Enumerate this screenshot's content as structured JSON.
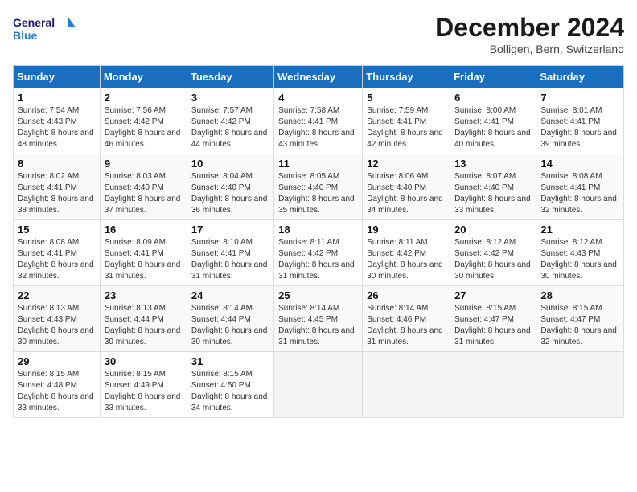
{
  "header": {
    "logo_line1": "General",
    "logo_line2": "Blue",
    "month": "December 2024",
    "location": "Bolligen, Bern, Switzerland"
  },
  "weekdays": [
    "Sunday",
    "Monday",
    "Tuesday",
    "Wednesday",
    "Thursday",
    "Friday",
    "Saturday"
  ],
  "weeks": [
    [
      {
        "day": "1",
        "sunrise": "7:54 AM",
        "sunset": "4:43 PM",
        "daylight": "8 hours and 48 minutes."
      },
      {
        "day": "2",
        "sunrise": "7:56 AM",
        "sunset": "4:42 PM",
        "daylight": "8 hours and 46 minutes."
      },
      {
        "day": "3",
        "sunrise": "7:57 AM",
        "sunset": "4:42 PM",
        "daylight": "8 hours and 44 minutes."
      },
      {
        "day": "4",
        "sunrise": "7:58 AM",
        "sunset": "4:41 PM",
        "daylight": "8 hours and 43 minutes."
      },
      {
        "day": "5",
        "sunrise": "7:59 AM",
        "sunset": "4:41 PM",
        "daylight": "8 hours and 42 minutes."
      },
      {
        "day": "6",
        "sunrise": "8:00 AM",
        "sunset": "4:41 PM",
        "daylight": "8 hours and 40 minutes."
      },
      {
        "day": "7",
        "sunrise": "8:01 AM",
        "sunset": "4:41 PM",
        "daylight": "8 hours and 39 minutes."
      }
    ],
    [
      {
        "day": "8",
        "sunrise": "8:02 AM",
        "sunset": "4:41 PM",
        "daylight": "8 hours and 38 minutes."
      },
      {
        "day": "9",
        "sunrise": "8:03 AM",
        "sunset": "4:40 PM",
        "daylight": "8 hours and 37 minutes."
      },
      {
        "day": "10",
        "sunrise": "8:04 AM",
        "sunset": "4:40 PM",
        "daylight": "8 hours and 36 minutes."
      },
      {
        "day": "11",
        "sunrise": "8:05 AM",
        "sunset": "4:40 PM",
        "daylight": "8 hours and 35 minutes."
      },
      {
        "day": "12",
        "sunrise": "8:06 AM",
        "sunset": "4:40 PM",
        "daylight": "8 hours and 34 minutes."
      },
      {
        "day": "13",
        "sunrise": "8:07 AM",
        "sunset": "4:40 PM",
        "daylight": "8 hours and 33 minutes."
      },
      {
        "day": "14",
        "sunrise": "8:08 AM",
        "sunset": "4:41 PM",
        "daylight": "8 hours and 32 minutes."
      }
    ],
    [
      {
        "day": "15",
        "sunrise": "8:08 AM",
        "sunset": "4:41 PM",
        "daylight": "8 hours and 32 minutes."
      },
      {
        "day": "16",
        "sunrise": "8:09 AM",
        "sunset": "4:41 PM",
        "daylight": "8 hours and 31 minutes."
      },
      {
        "day": "17",
        "sunrise": "8:10 AM",
        "sunset": "4:41 PM",
        "daylight": "8 hours and 31 minutes."
      },
      {
        "day": "18",
        "sunrise": "8:11 AM",
        "sunset": "4:42 PM",
        "daylight": "8 hours and 31 minutes."
      },
      {
        "day": "19",
        "sunrise": "8:11 AM",
        "sunset": "4:42 PM",
        "daylight": "8 hours and 30 minutes."
      },
      {
        "day": "20",
        "sunrise": "8:12 AM",
        "sunset": "4:42 PM",
        "daylight": "8 hours and 30 minutes."
      },
      {
        "day": "21",
        "sunrise": "8:12 AM",
        "sunset": "4:43 PM",
        "daylight": "8 hours and 30 minutes."
      }
    ],
    [
      {
        "day": "22",
        "sunrise": "8:13 AM",
        "sunset": "4:43 PM",
        "daylight": "8 hours and 30 minutes."
      },
      {
        "day": "23",
        "sunrise": "8:13 AM",
        "sunset": "4:44 PM",
        "daylight": "8 hours and 30 minutes."
      },
      {
        "day": "24",
        "sunrise": "8:14 AM",
        "sunset": "4:44 PM",
        "daylight": "8 hours and 30 minutes."
      },
      {
        "day": "25",
        "sunrise": "8:14 AM",
        "sunset": "4:45 PM",
        "daylight": "8 hours and 31 minutes."
      },
      {
        "day": "26",
        "sunrise": "8:14 AM",
        "sunset": "4:46 PM",
        "daylight": "8 hours and 31 minutes."
      },
      {
        "day": "27",
        "sunrise": "8:15 AM",
        "sunset": "4:47 PM",
        "daylight": "8 hours and 31 minutes."
      },
      {
        "day": "28",
        "sunrise": "8:15 AM",
        "sunset": "4:47 PM",
        "daylight": "8 hours and 32 minutes."
      }
    ],
    [
      {
        "day": "29",
        "sunrise": "8:15 AM",
        "sunset": "4:48 PM",
        "daylight": "8 hours and 33 minutes."
      },
      {
        "day": "30",
        "sunrise": "8:15 AM",
        "sunset": "4:49 PM",
        "daylight": "8 hours and 33 minutes."
      },
      {
        "day": "31",
        "sunrise": "8:15 AM",
        "sunset": "4:50 PM",
        "daylight": "8 hours and 34 minutes."
      },
      null,
      null,
      null,
      null
    ]
  ],
  "labels": {
    "sunrise_prefix": "Sunrise: ",
    "sunset_prefix": "Sunset: ",
    "daylight_prefix": "Daylight: "
  }
}
